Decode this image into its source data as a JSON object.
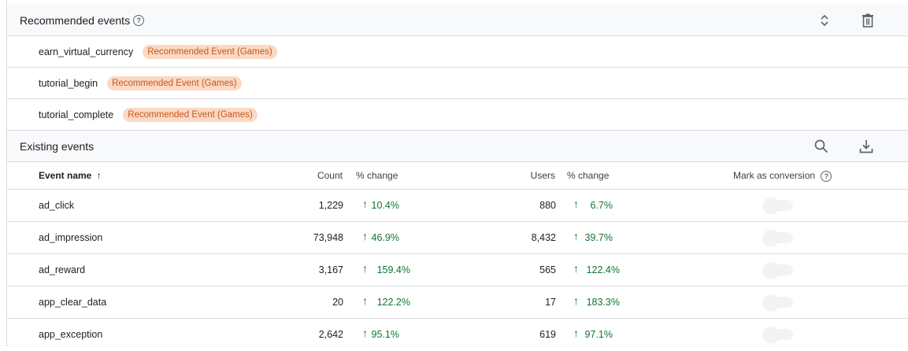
{
  "recommended": {
    "title": "Recommended events",
    "help": "?",
    "items": [
      {
        "name": "earn_virtual_currency",
        "chip": "Recommended Event (Games)"
      },
      {
        "name": "tutorial_begin",
        "chip": "Recommended Event (Games)"
      },
      {
        "name": "tutorial_complete",
        "chip": "Recommended Event (Games)"
      }
    ]
  },
  "existing": {
    "title": "Existing events",
    "columns": {
      "event_name": "Event name",
      "sort_arrow": "↑",
      "count": "Count",
      "count_change": "% change",
      "users": "Users",
      "users_change": "% change",
      "conversion": "Mark as conversion",
      "conversion_help": "?"
    },
    "rows": [
      {
        "name": "ad_click",
        "count": "1,229",
        "count_change": "10.4%",
        "users": "880",
        "users_change": "6.7%",
        "conversion": false
      },
      {
        "name": "ad_impression",
        "count": "73,948",
        "count_change": "46.9%",
        "users": "8,432",
        "users_change": "39.7%",
        "conversion": false
      },
      {
        "name": "ad_reward",
        "count": "3,167",
        "count_change": "159.4%",
        "users": "565",
        "users_change": "122.4%",
        "conversion": false
      },
      {
        "name": "app_clear_data",
        "count": "20",
        "count_change": "122.2%",
        "users": "17",
        "users_change": "183.3%",
        "conversion": false
      },
      {
        "name": "app_exception",
        "count": "2,642",
        "count_change": "95.1%",
        "users": "619",
        "users_change": "97.1%",
        "conversion": false
      }
    ]
  },
  "icons": {
    "expand": "unfold-icon",
    "delete": "trash-icon",
    "search": "search-icon",
    "download": "download-icon",
    "trend": "arrow-up-icon"
  },
  "colors": {
    "chip_bg": "#fbd9c4",
    "chip_text": "#c5581b",
    "positive": "#137333"
  }
}
